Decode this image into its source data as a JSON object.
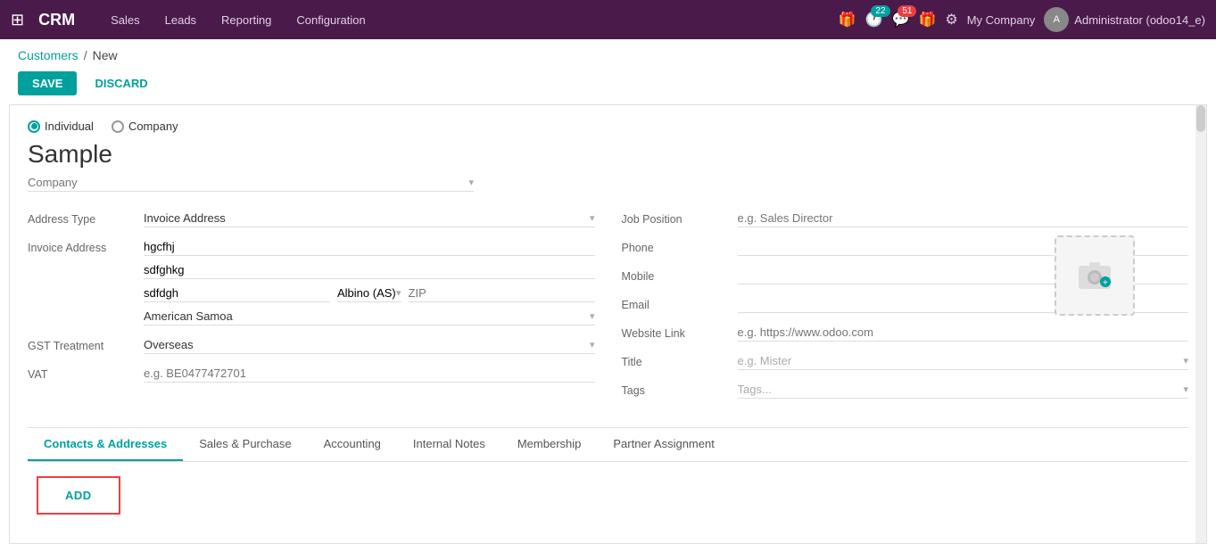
{
  "nav": {
    "brand": "CRM",
    "links": [
      "Sales",
      "Leads",
      "Reporting",
      "Configuration"
    ],
    "badge_calendar": "22",
    "badge_chat": "51",
    "company": "My Company",
    "user": "Administrator (odoo14_e)"
  },
  "breadcrumb": {
    "parent": "Customers",
    "separator": "/",
    "current": "New"
  },
  "toolbar": {
    "save_label": "SAVE",
    "discard_label": "DISCARD"
  },
  "form": {
    "radio": {
      "individual_label": "Individual",
      "company_label": "Company",
      "selected": "individual"
    },
    "name": "Sample",
    "company_placeholder": "Company",
    "left": {
      "address_type_label": "Address Type",
      "address_type_value": "Invoice Address",
      "invoice_address_label": "Invoice Address",
      "invoice_line1": "hgcfhj",
      "invoice_line2": "sdfghkg",
      "invoice_city": "sdfdgh",
      "invoice_state": "Albino (AS)",
      "invoice_zip_placeholder": "ZIP",
      "invoice_country": "American Samoa",
      "gst_label": "GST Treatment",
      "gst_value": "Overseas",
      "vat_label": "VAT",
      "vat_placeholder": "e.g. BE0477472701"
    },
    "right": {
      "job_position_label": "Job Position",
      "job_position_placeholder": "e.g. Sales Director",
      "phone_label": "Phone",
      "mobile_label": "Mobile",
      "email_label": "Email",
      "website_label": "Website Link",
      "website_placeholder": "e.g. https://www.odoo.com",
      "title_label": "Title",
      "title_placeholder": "e.g. Mister",
      "tags_label": "Tags",
      "tags_placeholder": "Tags..."
    }
  },
  "tabs": [
    {
      "id": "contacts",
      "label": "Contacts & Addresses",
      "active": true
    },
    {
      "id": "sales",
      "label": "Sales & Purchase",
      "active": false
    },
    {
      "id": "accounting",
      "label": "Accounting",
      "active": false
    },
    {
      "id": "notes",
      "label": "Internal Notes",
      "active": false
    },
    {
      "id": "membership",
      "label": "Membership",
      "active": false
    },
    {
      "id": "partner",
      "label": "Partner Assignment",
      "active": false
    }
  ],
  "tab_content": {
    "add_label": "ADD"
  }
}
